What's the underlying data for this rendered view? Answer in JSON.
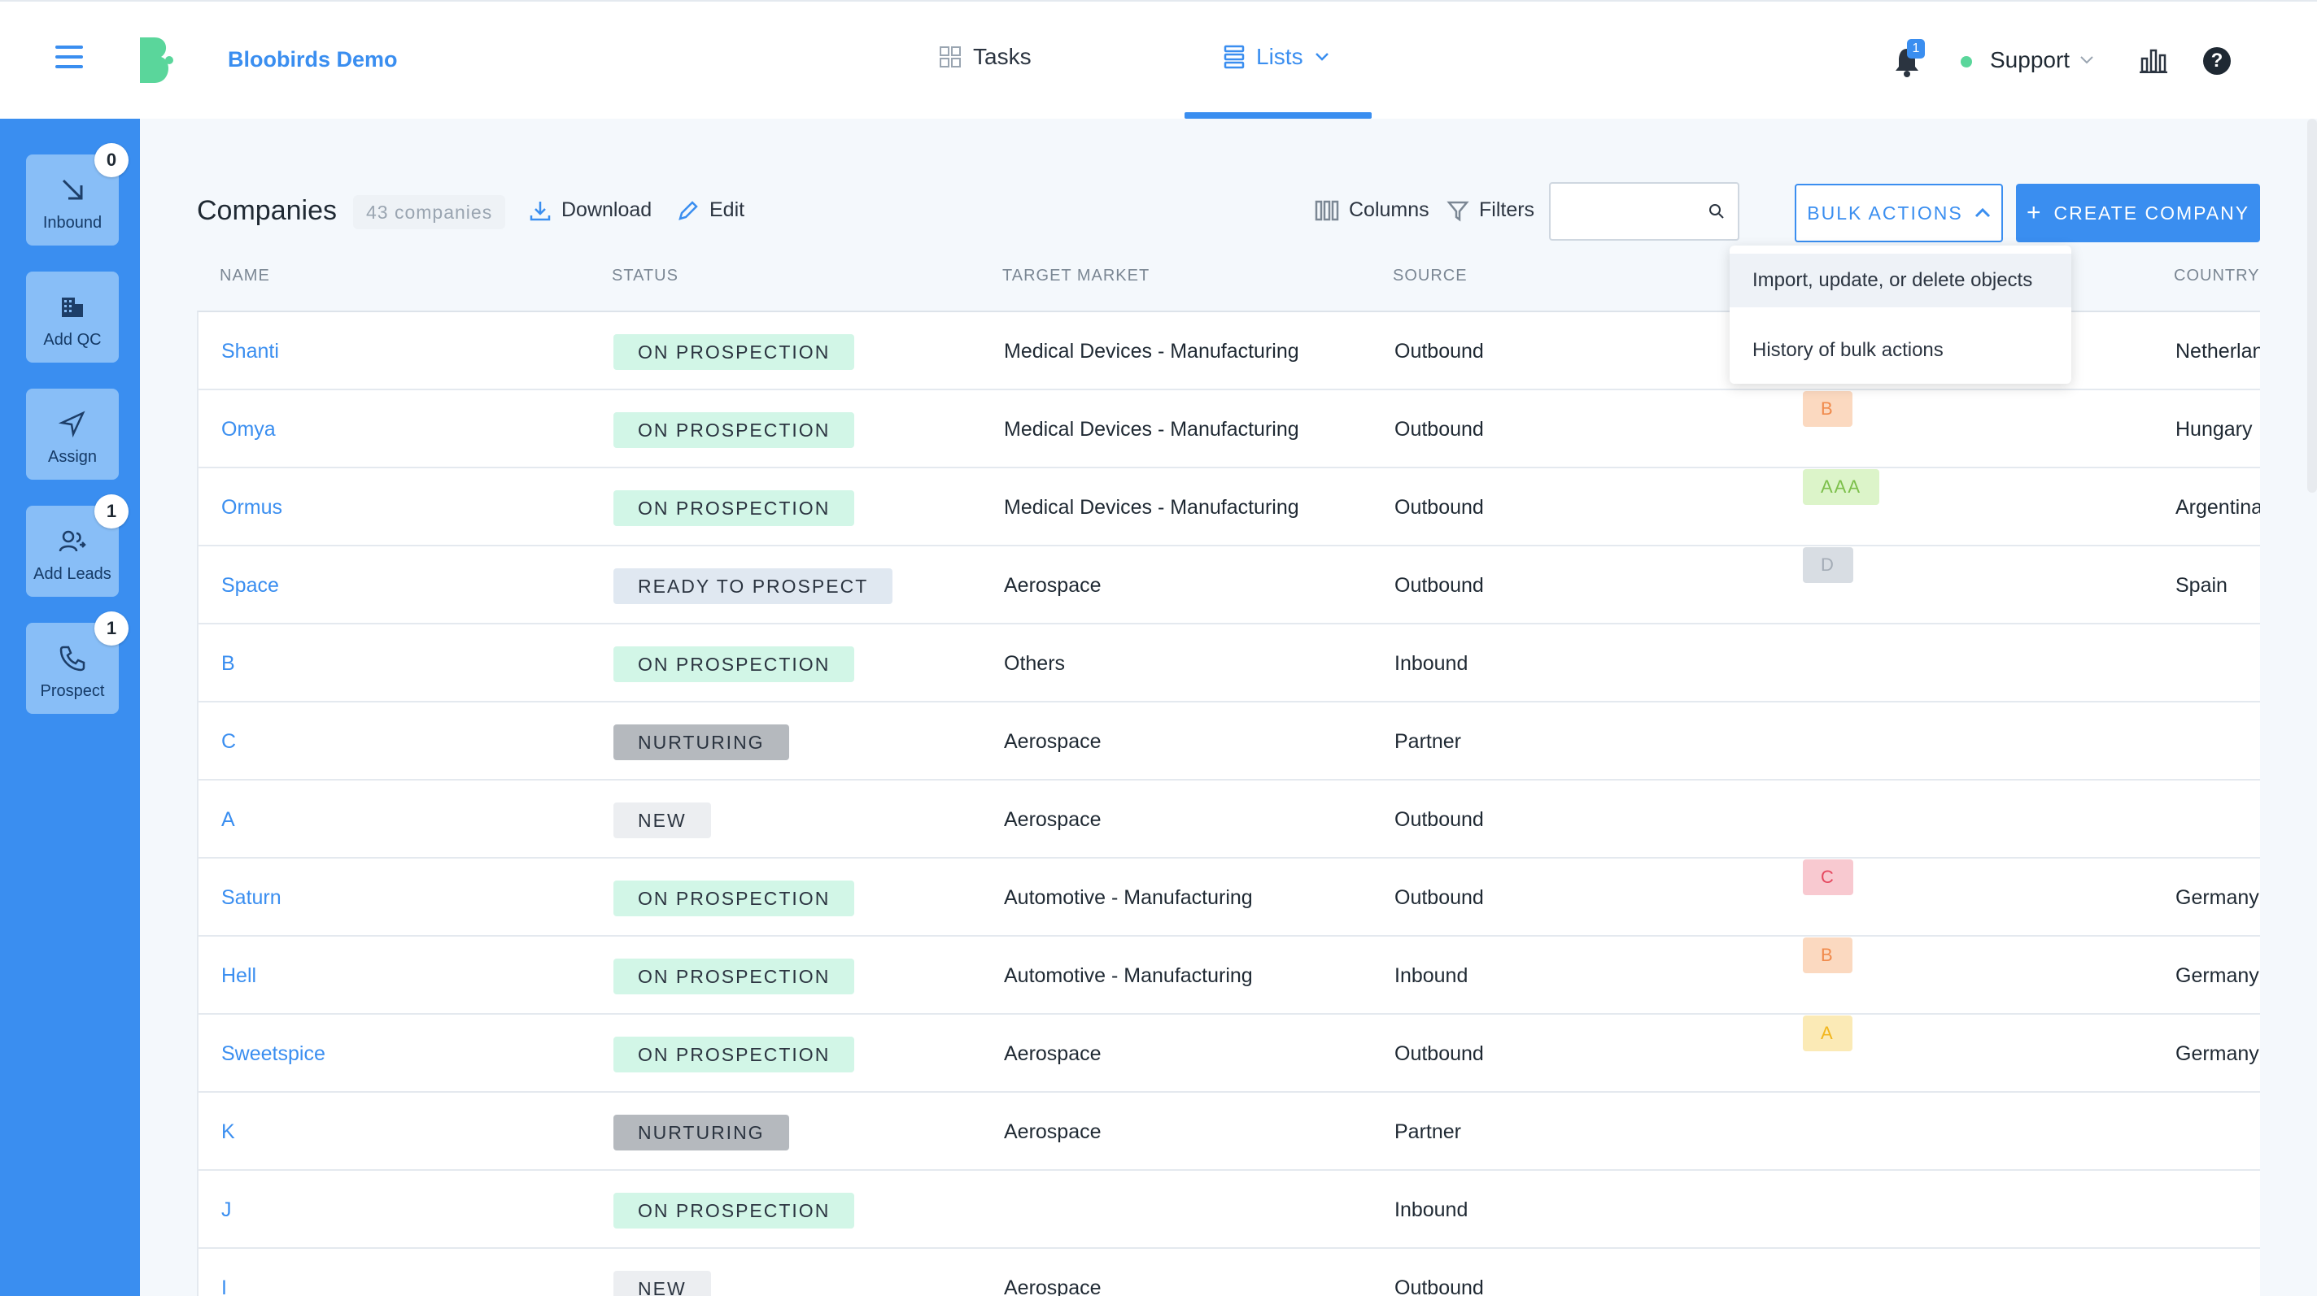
{
  "app": {
    "brand": "Bloobirds Demo"
  },
  "nav": {
    "tasks_label": "Tasks",
    "lists_label": "Lists",
    "notification_count": "1",
    "user": "Support"
  },
  "sidebar": {
    "items": [
      {
        "label": "Inbound",
        "badge": "0",
        "icon": "arrow-down-right-icon"
      },
      {
        "label": "Add QC",
        "badge": "",
        "icon": "building-icon"
      },
      {
        "label": "Assign",
        "badge": "",
        "icon": "send-icon"
      },
      {
        "label": "Add Leads",
        "badge": "1",
        "icon": "users-icon"
      },
      {
        "label": "Prospect",
        "badge": "1",
        "icon": "phone-icon"
      }
    ]
  },
  "toolbar": {
    "title": "Companies",
    "count": "43 companies",
    "download_label": "Download",
    "edit_label": "Edit",
    "columns_label": "Columns",
    "filters_label": "Filters",
    "search_placeholder": "",
    "bulk_actions_label": "BULK ACTIONS",
    "create_label": "CREATE COMPANY"
  },
  "bulk_menu": {
    "items": [
      "Import, update, or delete objects",
      "History of bulk actions"
    ]
  },
  "table": {
    "headers": {
      "name": "NAME",
      "status": "STATUS",
      "market": "TARGET MARKET",
      "source": "SOURCE",
      "country": "COUNTRY"
    },
    "rows": [
      {
        "name": "Shanti",
        "status": "ON PROSPECTION",
        "market": "Medical Devices - Manufacturing",
        "source": "Outbound",
        "score": "",
        "country": "Netherlan"
      },
      {
        "name": "Omya",
        "status": "ON PROSPECTION",
        "market": "Medical Devices - Manufacturing",
        "source": "Outbound",
        "score": "B",
        "country": "Hungary"
      },
      {
        "name": "Ormus",
        "status": "ON PROSPECTION",
        "market": "Medical Devices - Manufacturing",
        "source": "Outbound",
        "score": "AAA",
        "country": "Argentina"
      },
      {
        "name": "Space",
        "status": "READY TO PROSPECT",
        "market": "Aerospace",
        "source": "Outbound",
        "score": "D",
        "country": "Spain"
      },
      {
        "name": "B",
        "status": "ON PROSPECTION",
        "market": "Others",
        "source": "Inbound",
        "score": "",
        "country": ""
      },
      {
        "name": "C",
        "status": "NURTURING",
        "market": "Aerospace",
        "source": "Partner",
        "score": "",
        "country": ""
      },
      {
        "name": "A",
        "status": "NEW",
        "market": "Aerospace",
        "source": "Outbound",
        "score": "",
        "country": ""
      },
      {
        "name": "Saturn",
        "status": "ON PROSPECTION",
        "market": "Automotive - Manufacturing",
        "source": "Outbound",
        "score": "C",
        "country": "Germany"
      },
      {
        "name": "Hell",
        "status": "ON PROSPECTION",
        "market": "Automotive - Manufacturing",
        "source": "Inbound",
        "score": "B",
        "country": "Germany"
      },
      {
        "name": "Sweetspice",
        "status": "ON PROSPECTION",
        "market": "Aerospace",
        "source": "Outbound",
        "score": "A",
        "country": "Germany"
      },
      {
        "name": "K",
        "status": "NURTURING",
        "market": "Aerospace",
        "source": "Partner",
        "score": "",
        "country": ""
      },
      {
        "name": "J",
        "status": "ON PROSPECTION",
        "market": "",
        "source": "Inbound",
        "score": "",
        "country": ""
      },
      {
        "name": "I",
        "status": "NEW",
        "market": "Aerospace",
        "source": "Outbound",
        "score": "",
        "country": ""
      }
    ]
  },
  "colors": {
    "accent": "#3a8ef0",
    "status": {
      "ON PROSPECTION": {
        "bg": "#d2f6e7",
        "fg": "#2b3440"
      },
      "READY TO PROSPECT": {
        "bg": "#e0e8f1",
        "fg": "#2b3440"
      },
      "NURTURING": {
        "bg": "#b5b9be",
        "fg": "#2b3440"
      },
      "NEW": {
        "bg": "#eceef1",
        "fg": "#2b3440"
      }
    },
    "score": {
      "B": {
        "bg": "#fbd9c0",
        "fg": "#f08a4b"
      },
      "AAA": {
        "bg": "#dcf4c9",
        "fg": "#7cbf4a"
      },
      "D": {
        "bg": "#d8dde3",
        "fg": "#a4acb6"
      },
      "C": {
        "bg": "#f8c9d0",
        "fg": "#e5485f"
      },
      "A": {
        "bg": "#fbeab6",
        "fg": "#f2b61c"
      }
    }
  }
}
